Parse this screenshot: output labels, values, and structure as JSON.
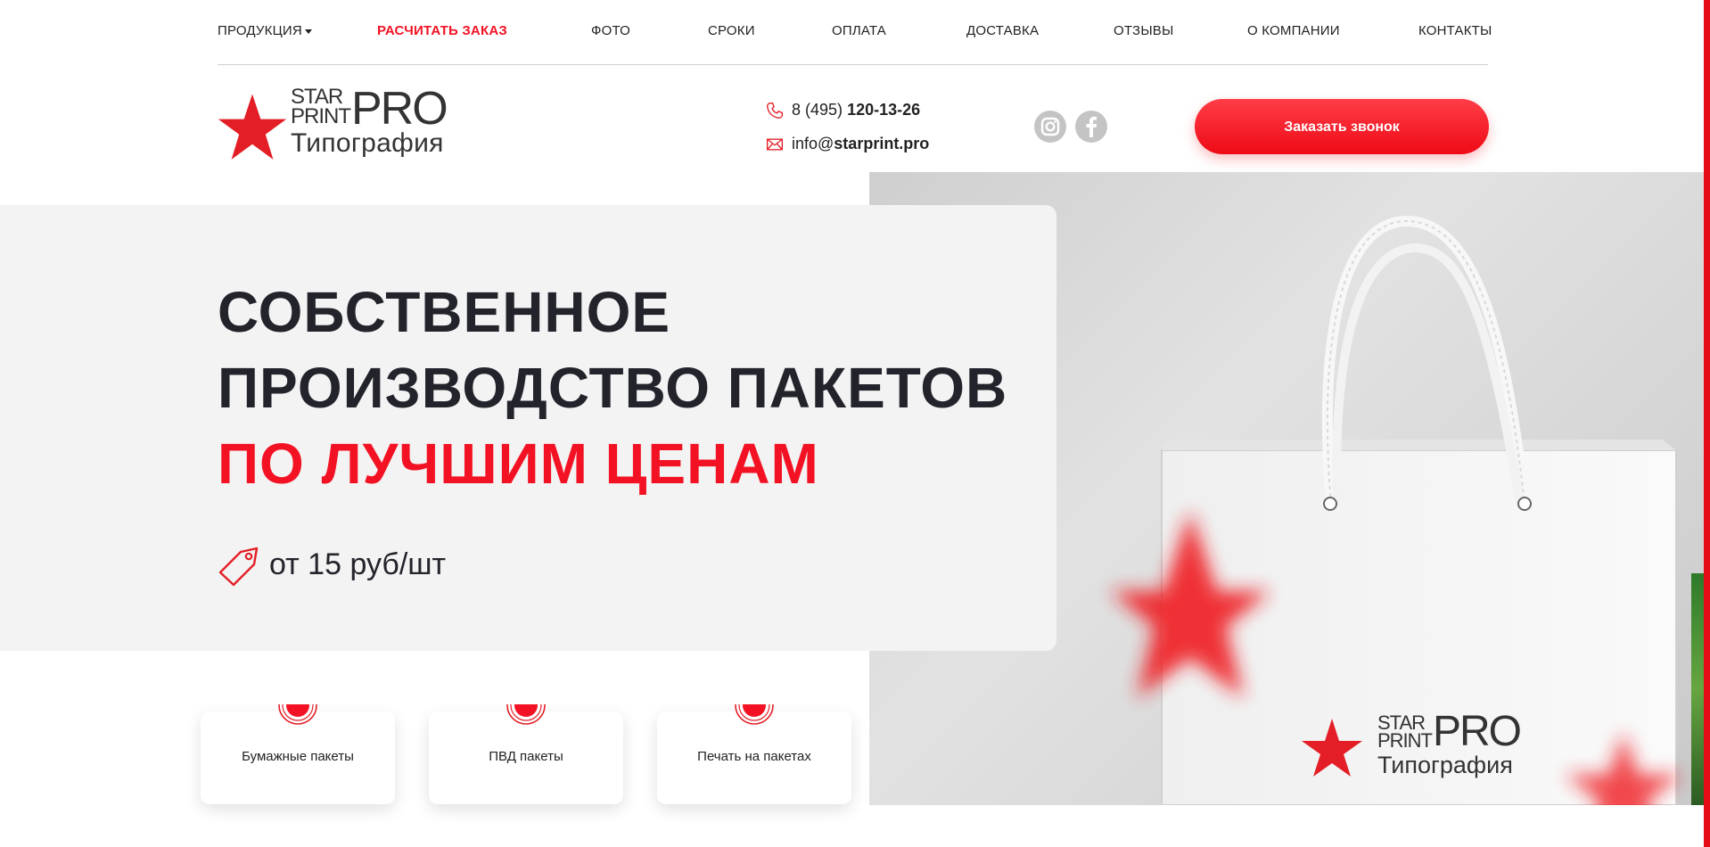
{
  "nav": {
    "items": [
      {
        "label": "ПРОДУКЦИЯ"
      },
      {
        "label": "РАСЧИТАТЬ ЗАКАЗ"
      },
      {
        "label": "ФОТО"
      },
      {
        "label": "СРОКИ"
      },
      {
        "label": "ОПЛАТА"
      },
      {
        "label": "ДОСТАВКА"
      },
      {
        "label": "ОТЗЫВЫ"
      },
      {
        "label": "О КОМПАНИИ"
      },
      {
        "label": "КОНТАКТЫ"
      }
    ],
    "accent_color": "#f31223"
  },
  "logo": {
    "line1": "STAR",
    "line2": "PRINT",
    "pro": "PRO",
    "subtitle": "Типография"
  },
  "contacts": {
    "phone_prefix": "8 (495)",
    "phone_number": "120-13-26",
    "email_user": "info@",
    "email_domain": "starprint.pro"
  },
  "social": [
    {
      "icon": "instagram-icon"
    },
    {
      "icon": "facebook-icon"
    }
  ],
  "cta": {
    "label": "Заказать звонок"
  },
  "hero": {
    "line1": "СОБСТВЕННОЕ",
    "line2": "ПРОИЗВОДСТВО ПАКЕТОВ",
    "line3": "ПО ЛУЧШИМ ЦЕНАМ",
    "price": "от 15 руб/шт",
    "photo_logo": {
      "line1": "STAR",
      "line2": "PRINT",
      "pro": "PRO",
      "subtitle": "Типография"
    }
  },
  "categories": [
    {
      "label": "Бумажные пакеты"
    },
    {
      "label": "ПВД пакеты"
    },
    {
      "label": "Печать на пакетах"
    }
  ],
  "colors": {
    "brand_red": "#f31223",
    "dark_text": "#23242b",
    "hero_bg": "#f3f3f3"
  }
}
